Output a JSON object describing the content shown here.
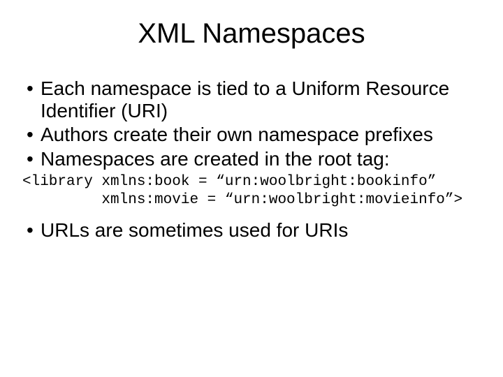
{
  "title": "XML Namespaces",
  "bullets_a": [
    "Each namespace is tied to a Uniform Resource Identifier (URI)",
    "Authors create their own namespace prefixes",
    "Namespaces are created in the root tag:"
  ],
  "code": "<library xmlns:book = “urn:woolbright:bookinfo”\n         xmlns:movie = “urn:woolbright:movieinfo”>",
  "bullets_b": [
    "URLs are sometimes used for URIs"
  ]
}
